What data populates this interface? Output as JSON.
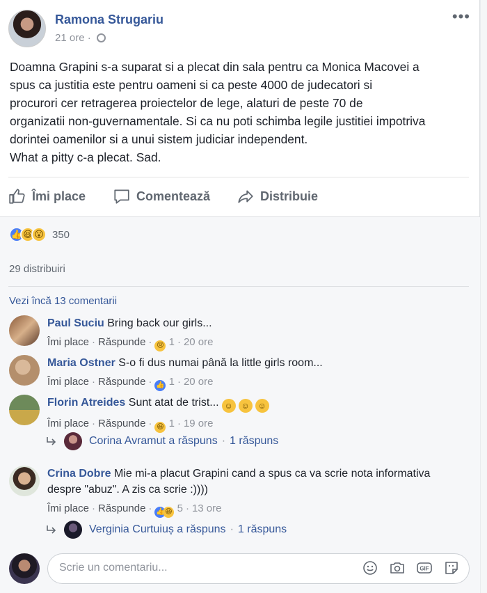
{
  "post": {
    "author": "Ramona Strugariu",
    "time": "21 ore",
    "text_lines": [
      "Doamna Grapini s-a suparat si a plecat din sala pentru ca Monica Macovei a",
      "spus ca justitia este pentru oameni si ca peste 4000 de judecatori si",
      "procurori cer retragerea proiectelor de lege, alaturi de peste 70 de",
      "organizatii non-guvernamentale. Si ca nu poti schimba legile justitiei impotriva",
      "dorintei oamenilor si a unui sistem judiciar independent.",
      "What a pitty c-a plecat. Sad."
    ]
  },
  "actions": {
    "like": "Îmi place",
    "comment": "Comentează",
    "share": "Distribuie"
  },
  "reactions": {
    "count": "350",
    "shares": "29 distribuiri",
    "view_more": "Vezi încă 13 comentarii"
  },
  "comments": [
    {
      "name": "Paul Suciu",
      "text": "Bring back our girls...",
      "like": "Îmi place",
      "reply": "Răspunde",
      "reaction_count": "1",
      "time": "20 ore"
    },
    {
      "name": "Maria Ostner",
      "text": "S-o fi dus numai până la little girls room...",
      "like": "Îmi place",
      "reply": "Răspunde",
      "reaction_count": "1",
      "time": "20 ore"
    },
    {
      "name": "Florin Atreides",
      "text": "Sunt atat de trist...",
      "like": "Îmi place",
      "reply": "Răspunde",
      "reaction_count": "1",
      "time": "19 ore",
      "reply_info": {
        "text": "Corina Avramut a răspuns",
        "count": "1 răspuns"
      }
    },
    {
      "name": "Crina Dobre",
      "text_line1": "Mie mi-a placut Grapini cand a spus ca va scrie nota informativa",
      "text_line2": "despre \"abuz\". A zis ca scrie :))))",
      "like": "Îmi place",
      "reply": "Răspunde",
      "reaction_count": "5",
      "time": "13 ore",
      "reply_info": {
        "text": "Verginia Curtuiuș a răspuns",
        "count": "1 răspuns"
      }
    }
  ],
  "composer": {
    "placeholder": "Scrie un comentariu..."
  },
  "colors": {
    "link": "#365899",
    "muted": "#90949c",
    "like_blue": "#4a7ef7",
    "emoji_yellow": "#f7c33e"
  }
}
